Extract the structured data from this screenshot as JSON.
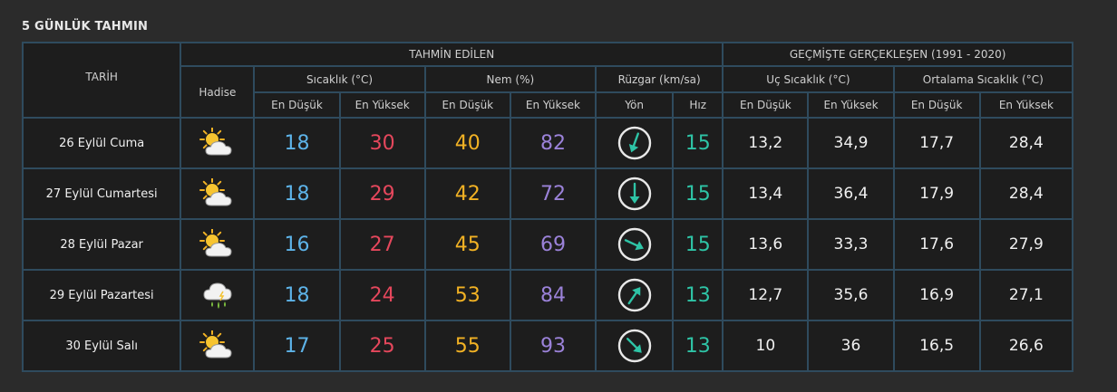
{
  "title": "5 GÜNLÜK TAHMIN",
  "headers": {
    "tarih": "TARİH",
    "tahmin": "TAHMİN EDİLEN",
    "gecmis": "GEÇMİŞTE GERÇEKLEŞEN (1991 - 2020)",
    "hadise": "Hadise",
    "sicaklik": "Sıcaklık (°C)",
    "nem": "Nem (%)",
    "ruzgar": "Rüzgar (km/sa)",
    "uc": "Uç Sıcaklık (°C)",
    "ortalama": "Ortalama Sıcaklık (°C)",
    "en_dusuk": "En Düşük",
    "en_yuksek": "En Yüksek",
    "yon": "Yön",
    "hiz": "Hız"
  },
  "colors": {
    "blue": "#5db3e8",
    "red": "#e5475c",
    "yellow": "#f2b224",
    "purple": "#9b82d9",
    "teal": "#2ec4a6",
    "border": "#2f4b5e"
  },
  "rows": [
    {
      "date": "26 Eylül Cuma",
      "icon": "partly-cloudy-icon",
      "tmin": "18",
      "tmax": "30",
      "hmin": "40",
      "hmax": "82",
      "wind_deg": 20,
      "speed": "15",
      "uc_min": "13,2",
      "uc_max": "34,9",
      "ort_min": "17,7",
      "ort_max": "28,4"
    },
    {
      "date": "27 Eylül Cumartesi",
      "icon": "partly-cloudy-icon",
      "tmin": "18",
      "tmax": "29",
      "hmin": "42",
      "hmax": "72",
      "wind_deg": 0,
      "speed": "15",
      "uc_min": "13,4",
      "uc_max": "36,4",
      "ort_min": "17,9",
      "ort_max": "28,4"
    },
    {
      "date": "28 Eylül Pazar",
      "icon": "partly-cloudy-icon",
      "tmin": "16",
      "tmax": "27",
      "hmin": "45",
      "hmax": "69",
      "wind_deg": 295,
      "speed": "15",
      "uc_min": "13,6",
      "uc_max": "33,3",
      "ort_min": "17,6",
      "ort_max": "27,9"
    },
    {
      "date": "29 Eylül Pazartesi",
      "icon": "rain-cloud-icon",
      "tmin": "18",
      "tmax": "24",
      "hmin": "53",
      "hmax": "84",
      "wind_deg": 215,
      "speed": "13",
      "uc_min": "12,7",
      "uc_max": "35,6",
      "ort_min": "16,9",
      "ort_max": "27,1"
    },
    {
      "date": "30 Eylül Salı",
      "icon": "partly-cloudy-icon",
      "tmin": "17",
      "tmax": "25",
      "hmin": "55",
      "hmax": "93",
      "wind_deg": 315,
      "speed": "13",
      "uc_min": "10",
      "uc_max": "36",
      "ort_min": "16,5",
      "ort_max": "26,6"
    }
  ]
}
